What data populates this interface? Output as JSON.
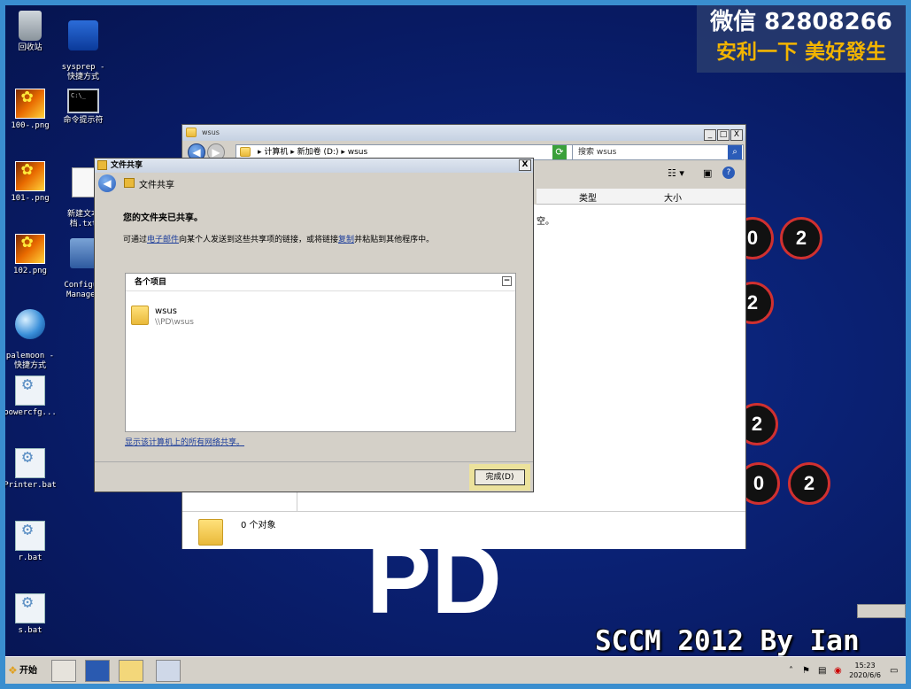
{
  "watermark": {
    "line1": "微信 82808266",
    "line2": "安利一下 美好發生"
  },
  "desktop_icons": [
    {
      "label": "回收站",
      "icon": "recycle-bin-icon"
    },
    {
      "label": "sysprep -\n快捷方式",
      "icon": "network-shortcut-icon"
    },
    {
      "label": "100-.png",
      "icon": "png-image-icon"
    },
    {
      "label": "命令提示符",
      "icon": "command-prompt-icon"
    },
    {
      "label": "101-.png",
      "icon": "png-image-icon"
    },
    {
      "label": "新建文本\n档.txt",
      "icon": "text-document-icon"
    },
    {
      "label": "102.png",
      "icon": "png-image-icon"
    },
    {
      "label": "Configur\nManager",
      "icon": "config-manager-icon"
    },
    {
      "label": "palemoon -\n快捷方式",
      "icon": "palemoon-icon"
    },
    {
      "label": "powercfg...",
      "icon": "batch-file-icon"
    },
    {
      "label": "Printer.bat",
      "icon": "batch-file-icon"
    },
    {
      "label": "r.bat",
      "icon": "batch-file-icon"
    },
    {
      "label": "s.bat",
      "icon": "batch-file-icon"
    }
  ],
  "background": {
    "logo_text": "PD",
    "badges": [
      "0",
      "2",
      "2",
      "2",
      "0",
      "2"
    ],
    "caption": "SCCM 2012 By Ian"
  },
  "explorer": {
    "title": "wsus",
    "address": "▸ 计算机 ▸ 新加卷 (D:) ▸ wsus",
    "search_placeholder": "搜索 wsus",
    "columns": [
      "类型",
      "大小"
    ],
    "empty_text_fragment": "空。",
    "status_count": "0 个对象",
    "buttons": {
      "minimize": "_",
      "maximize": "□",
      "close": "X"
    }
  },
  "dialog": {
    "title": "文件共享",
    "header": "文件共享",
    "shared_message": "您的文件夹已共享。",
    "email_line_prefix": "可通过",
    "email_link": "电子邮件",
    "email_line_middle": "向某个人发送到这些共享项的链接，或将链接",
    "copy_link": "复制",
    "email_line_suffix": "并粘贴到其他程序中。",
    "items_header": "各个项目",
    "item_name": "wsus",
    "item_path": "\\\\PD\\wsus",
    "show_all_link": "显示该计算机上的所有网络共享。",
    "done_button": "完成(D)",
    "close": "X",
    "collapse": "−"
  },
  "taskbar": {
    "start_label": "开始",
    "time": "15:23",
    "date": "2020/6/6"
  }
}
